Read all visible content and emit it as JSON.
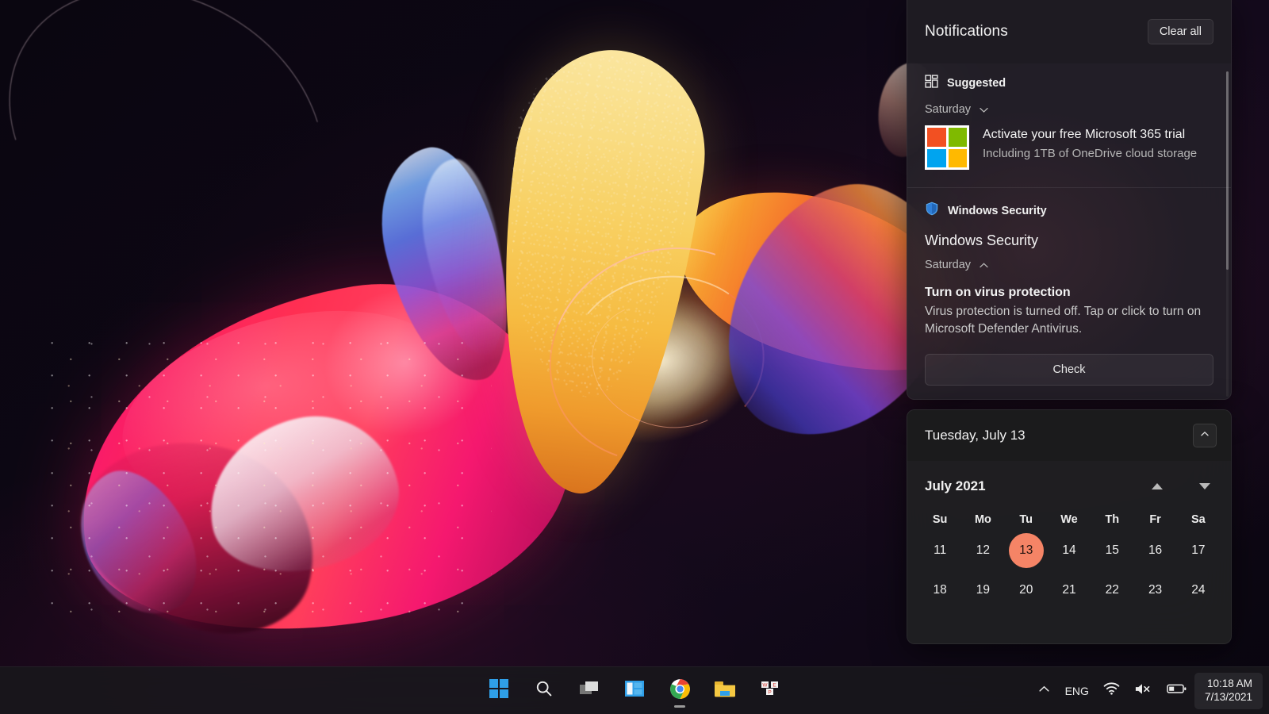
{
  "notifications": {
    "title": "Notifications",
    "clear_all_label": "Clear all",
    "suggested": {
      "group_label": "Suggested",
      "group_icon": "layout-grid-icon",
      "day_label": "Saturday",
      "day_chevron": "chevron-down-icon",
      "item": {
        "icon": "microsoft-logo-icon",
        "title": "Activate your free Microsoft 365 trial",
        "subtitle": "Including 1TB of OneDrive cloud storage"
      }
    },
    "security": {
      "app_label": "Windows Security",
      "app_icon": "shield-icon",
      "heading": "Windows Security",
      "day_label": "Saturday",
      "day_chevron": "chevron-up-icon",
      "message_title": "Turn on virus protection",
      "message_body": "Virus protection is turned off. Tap or click to turn on Microsoft Defender Antivirus.",
      "action_label": "Check"
    }
  },
  "calendar": {
    "header_date": "Tuesday, July 13",
    "collapse_icon": "chevron-up-icon",
    "month_label": "July 2021",
    "prev_icon": "triangle-up-icon",
    "next_icon": "triangle-down-icon",
    "weekdays": [
      "Su",
      "Mo",
      "Tu",
      "We",
      "Th",
      "Fr",
      "Sa"
    ],
    "weeks": [
      [
        "11",
        "12",
        "13",
        "14",
        "15",
        "16",
        "17"
      ],
      [
        "18",
        "19",
        "20",
        "21",
        "22",
        "23",
        "24"
      ]
    ],
    "today": "13",
    "today_color": "#f58466"
  },
  "taskbar": {
    "items": [
      {
        "name": "start-button",
        "icon": "windows-logo-icon",
        "running": false
      },
      {
        "name": "search-button",
        "icon": "search-icon",
        "running": false
      },
      {
        "name": "task-view-button",
        "icon": "task-view-icon",
        "running": false
      },
      {
        "name": "widgets-button",
        "icon": "widgets-icon",
        "running": false
      },
      {
        "name": "chrome-button",
        "icon": "chrome-icon",
        "running": true
      },
      {
        "name": "file-explorer-button",
        "icon": "folder-icon",
        "running": false
      },
      {
        "name": "microsoft-store-button",
        "icon": "store-icon",
        "running": false
      }
    ],
    "tray": {
      "overflow_icon": "chevron-up-icon",
      "language": "ENG",
      "wifi_icon": "wifi-icon",
      "volume_icon": "speaker-muted-icon",
      "battery_icon": "battery-icon",
      "time": "10:18 AM",
      "date": "7/13/2021"
    }
  }
}
